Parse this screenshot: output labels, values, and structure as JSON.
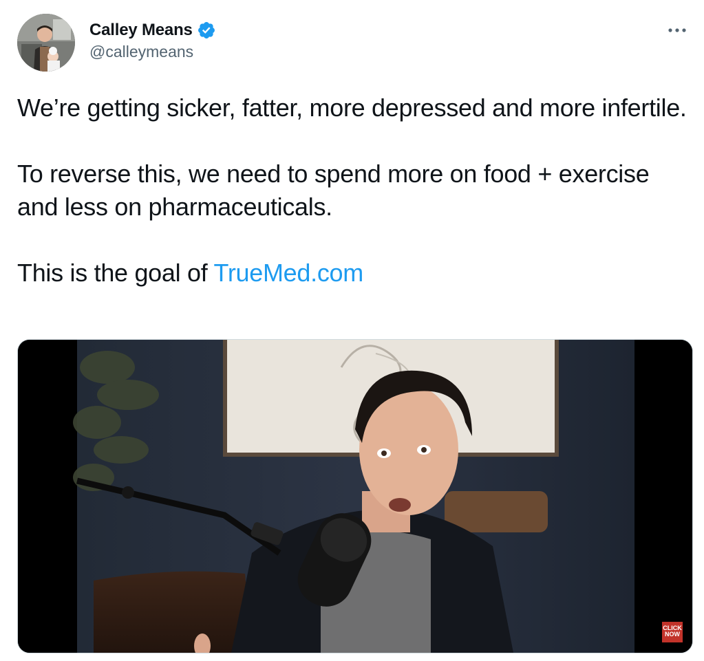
{
  "author": {
    "display_name": "Calley Means",
    "handle": "@calleymeans",
    "verified_icon": "verified-badge-icon",
    "avatar_icon": "profile-photo"
  },
  "menu": {
    "more_icon": "more-horizontal-icon"
  },
  "tweet": {
    "line1": "We’re getting sicker, fatter, more depressed and more infertile.",
    "line2": "To reverse this, we need to spend more on food + exercise and less on pharmaceuticals.",
    "line3_prefix": "This is the goal of ",
    "link_text": "TrueMed.com"
  },
  "media": {
    "type": "video-thumbnail",
    "overlay_badge_lines": [
      "CLICK",
      "NOW"
    ]
  },
  "colors": {
    "link": "#1d9bf0",
    "verified": "#1d9bf0",
    "text": "#0f1419",
    "secondary": "#536471"
  }
}
